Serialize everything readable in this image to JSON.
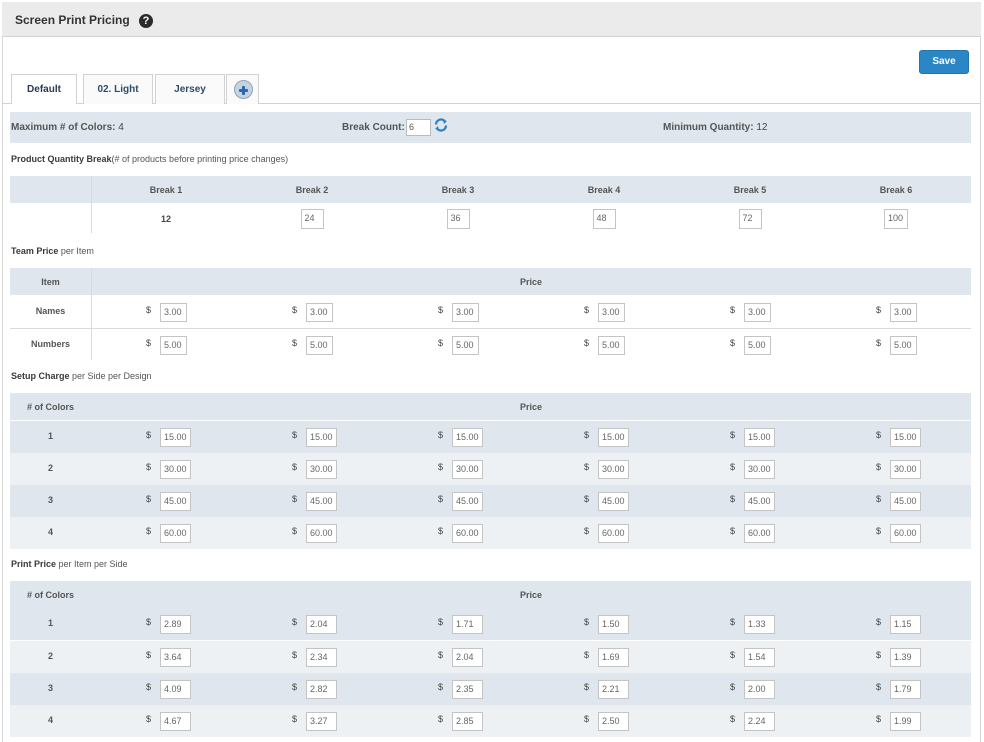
{
  "header": {
    "title": "Screen Print Pricing",
    "help_icon": "?"
  },
  "save_label": "Save",
  "tabs": [
    {
      "label": "Default",
      "active": true
    },
    {
      "label": "02. Light",
      "active": false
    },
    {
      "label": "Jersey",
      "active": false
    }
  ],
  "info": {
    "max_colors_label": "Maximum # of Colors:",
    "max_colors_value": "4",
    "break_count_label": "Break Count:",
    "break_count_value": "6",
    "min_qty_label": "Minimum Quantity:",
    "min_qty_value": "12"
  },
  "quantity_break": {
    "title_bold": "Product Quantity Break",
    "title_rest": "(# of products before printing price changes)",
    "headers": [
      "Break 1",
      "Break 2",
      "Break 3",
      "Break 4",
      "Break 5",
      "Break 6"
    ],
    "values": [
      "12",
      "24",
      "36",
      "48",
      "72",
      "100"
    ]
  },
  "team_price": {
    "title_bold": "Team Price",
    "title_rest": " per Item",
    "col_item": "Item",
    "col_price": "Price",
    "currency": "$",
    "rows": [
      {
        "label": "Names",
        "values": [
          "3.00",
          "3.00",
          "3.00",
          "3.00",
          "3.00",
          "3.00"
        ]
      },
      {
        "label": "Numbers",
        "values": [
          "5.00",
          "5.00",
          "5.00",
          "5.00",
          "5.00",
          "5.00"
        ]
      }
    ]
  },
  "setup_charge": {
    "title_bold": "Setup Charge",
    "title_rest": " per Side per Design",
    "col_colors": "# of Colors",
    "col_price": "Price",
    "currency": "$",
    "rows": [
      {
        "label": "1",
        "values": [
          "15.00",
          "15.00",
          "15.00",
          "15.00",
          "15.00",
          "15.00"
        ]
      },
      {
        "label": "2",
        "values": [
          "30.00",
          "30.00",
          "30.00",
          "30.00",
          "30.00",
          "30.00"
        ]
      },
      {
        "label": "3",
        "values": [
          "45.00",
          "45.00",
          "45.00",
          "45.00",
          "45.00",
          "45.00"
        ]
      },
      {
        "label": "4",
        "values": [
          "60.00",
          "60.00",
          "60.00",
          "60.00",
          "60.00",
          "60.00"
        ]
      }
    ]
  },
  "print_price": {
    "title_bold": "Print Price",
    "title_rest": " per Item per Side",
    "col_colors": "# of Colors",
    "col_price": "Price",
    "currency": "$",
    "rows": [
      {
        "label": "1",
        "values": [
          "2.89",
          "2.04",
          "1.71",
          "1.50",
          "1.33",
          "1.15"
        ]
      },
      {
        "label": "2",
        "values": [
          "3.64",
          "2.34",
          "2.04",
          "1.69",
          "1.54",
          "1.39"
        ]
      },
      {
        "label": "3",
        "values": [
          "4.09",
          "2.82",
          "2.35",
          "2.21",
          "2.00",
          "1.79"
        ]
      },
      {
        "label": "4",
        "values": [
          "4.67",
          "3.27",
          "2.85",
          "2.50",
          "2.24",
          "1.99"
        ]
      }
    ]
  },
  "colors": {
    "accent": "#2b86c6",
    "band": "#dfe6ed",
    "band_light": "#eef1f4"
  },
  "icons": {
    "help": "help-icon",
    "refresh": "refresh-icon",
    "add_tab": "plus-icon"
  }
}
